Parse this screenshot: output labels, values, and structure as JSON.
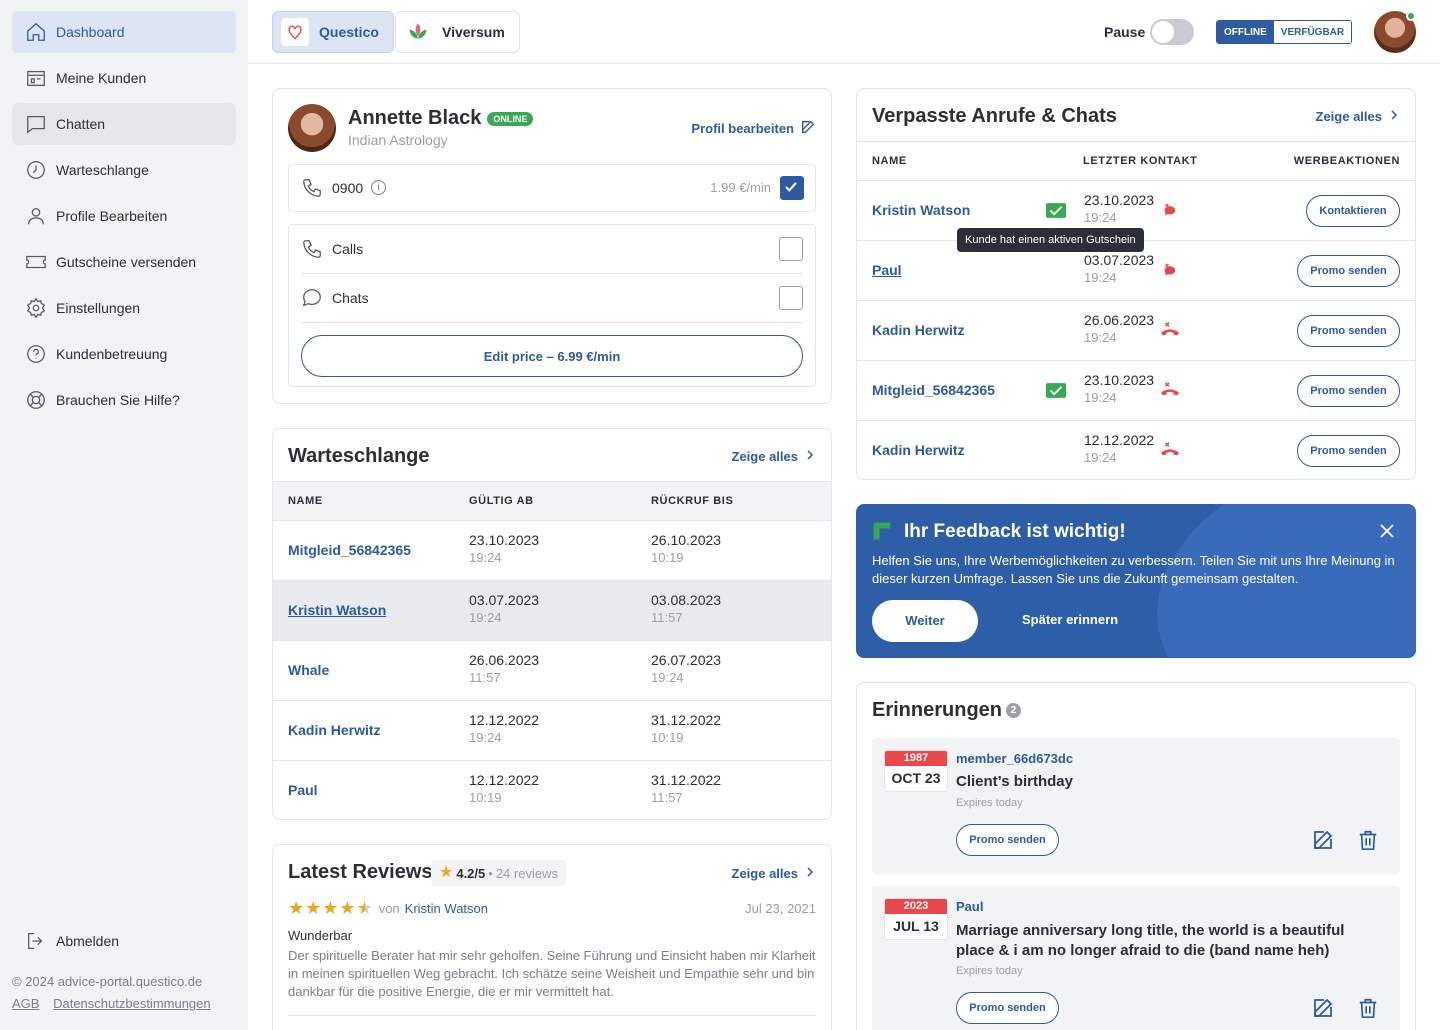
{
  "sidebar": {
    "items": [
      {
        "label": "Dashboard",
        "icon": "home-icon"
      },
      {
        "label": "Meine Kunden",
        "icon": "store-icon"
      },
      {
        "label": "Chatten",
        "icon": "chat-icon"
      },
      {
        "label": "Warteschlange",
        "icon": "clock-icon"
      },
      {
        "label": "Profile Bearbeiten",
        "icon": "user-icon"
      },
      {
        "label": "Gutscheine versenden",
        "icon": "ticket-icon"
      },
      {
        "label": "Einstellungen",
        "icon": "gear-icon"
      },
      {
        "label": "Kundenbetreuung",
        "icon": "help-circle-icon"
      },
      {
        "label": "Brauchen Sie Hilfe?",
        "icon": "lifebuoy-icon"
      }
    ],
    "logout": "Abmelden",
    "copyright": "© 2024 advice-portal.questico.de",
    "links": [
      "AGB",
      "Datenschutzbestimmungen"
    ]
  },
  "topbar": {
    "brands": [
      "Questico",
      "Viversum"
    ],
    "pause_label": "Pause",
    "status": [
      "OFFLINE",
      "VERFÜGBAR"
    ]
  },
  "profile": {
    "name": "Annette Black",
    "badge": "ONLINE",
    "subtitle": "Indian Astrology",
    "edit_label": "Profil bearbeiten",
    "phone": "0900",
    "price": "1.99 €/min",
    "calls_label": "Calls",
    "chats_label": "Chats",
    "edit_price": "Edit price – 6.99 €/min"
  },
  "queue": {
    "title": "Warteschlange",
    "show_all": "Zeige alles",
    "columns": [
      "NAME",
      "GÜLTIG AB",
      "RÜCKRUF BIS"
    ],
    "rows": [
      {
        "name": "Mitgleid_56842365",
        "from_date": "23.10.2023",
        "from_time": "19:24",
        "to_date": "26.10.2023",
        "to_time": "10:19"
      },
      {
        "name": "Kristin Watson",
        "from_date": "03.07.2023",
        "from_time": "19:24",
        "to_date": "03.08.2023",
        "to_time": "11:57"
      },
      {
        "name": "Whale",
        "from_date": "26.06.2023",
        "from_time": "11:57",
        "to_date": "26.07.2023",
        "to_time": "19:24"
      },
      {
        "name": "Kadin Herwitz",
        "from_date": "12.12.2022",
        "from_time": "19:24",
        "to_date": "31.12.2022",
        "to_time": "10:19"
      },
      {
        "name": "Paul",
        "from_date": "12.12.2022",
        "from_time": "10:19",
        "to_date": "31.12.2022",
        "to_time": "11:57"
      }
    ]
  },
  "reviews": {
    "title": "Latest Reviews",
    "rating": "4.2/5",
    "count": "24 reviews",
    "show_all": "Zeige alles",
    "items": [
      {
        "by": "von",
        "author": "Kristin Watson",
        "date": "Jul 23, 2021",
        "headline": "Wunderbar",
        "text": "Der spirituelle Berater hat mir sehr geholfen. Seine Führung und Einsicht haben mir Klarheit in meinen spirituellen Weg gebracht. Ich schätze seine Weisheit und Empathie sehr und bin dankbar für die positive Energie, die er mir vermittelt hat.",
        "stars": 4.5
      }
    ]
  },
  "missed": {
    "title": "Verpasste Anrufe & Chats",
    "show_all": "Zeige alles",
    "columns": [
      "NAME",
      "LETZTER KONTAKT",
      "WERBEAKTIONEN"
    ],
    "tooltip": "Kunde hat einen aktiven Gutschein",
    "rows": [
      {
        "name": "Kristin Watson",
        "voucher": true,
        "date": "23.10.2023",
        "time": "19:24",
        "type": "chat",
        "action": "Kontaktieren"
      },
      {
        "name": "Paul",
        "voucher": false,
        "date": "03.07.2023",
        "time": "19:24",
        "type": "chat",
        "action": "Promo senden"
      },
      {
        "name": "Kadin Herwitz",
        "voucher": false,
        "date": "26.06.2023",
        "time": "19:24",
        "type": "call",
        "action": "Promo senden"
      },
      {
        "name": "Mitgleid_56842365",
        "voucher": true,
        "date": "23.10.2023",
        "time": "19:24",
        "type": "call",
        "action": "Promo senden"
      },
      {
        "name": "Kadin Herwitz",
        "voucher": false,
        "date": "12.12.2022",
        "time": "19:24",
        "type": "call",
        "action": "Promo senden"
      }
    ]
  },
  "feedback": {
    "title": "Ihr Feedback ist wichtig!",
    "text": "Helfen Sie uns, Ihre Werbemöglichkeiten zu verbessern. Teilen Sie mit uns Ihre Meinung in dieser kurzen Umfrage. Lassen Sie uns die Zukunft gemeinsam gestalten.",
    "primary": "Weiter",
    "secondary": "Später erinnern"
  },
  "reminders": {
    "title": "Erinnerungen",
    "count": "2",
    "items": [
      {
        "year": "1987",
        "date": "OCT 23",
        "member": "member_66d673dc",
        "title": "Client’s birthday",
        "expires": "Expires today",
        "action": "Promo senden"
      },
      {
        "year": "2023",
        "date": "JUL 13",
        "member": "Paul",
        "title": "Marriage anniversary long title, the world is a beautiful place & i am no longer afraid to die (band name heh)",
        "expires": "Expires today",
        "action": "Promo senden"
      }
    ]
  },
  "colors": {
    "accent": "#2d5aa0",
    "online": "#3aa757",
    "missed": "#e8474b",
    "feedback_bg": "#2f5ea8"
  }
}
